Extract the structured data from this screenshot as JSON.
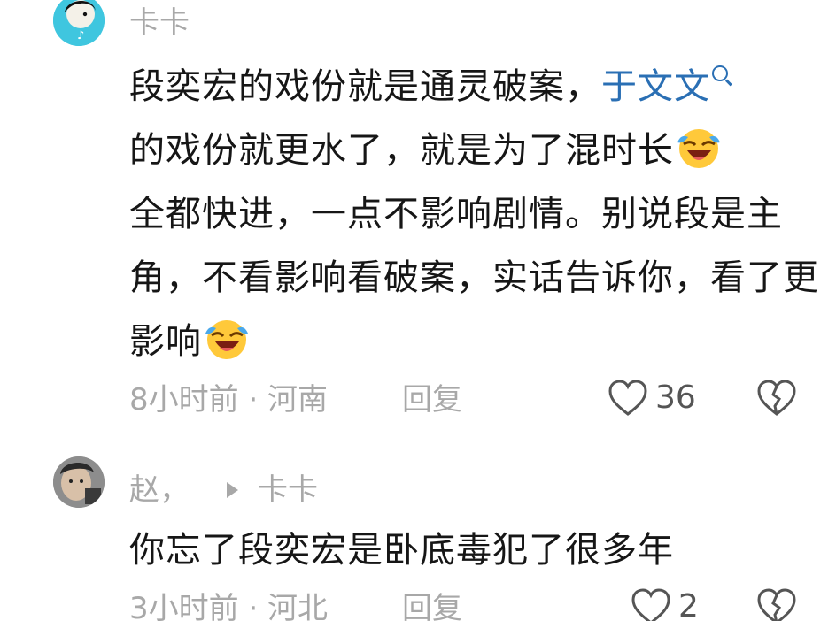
{
  "comments": [
    {
      "username": "卡卡",
      "text_parts": {
        "line_a": "段奕宏的戏份就是通灵破案，",
        "mention": "于文文",
        "line_b": "的戏份就更水了，就是为了混时长",
        "line_c": "全都快进，一点不影响剧情。别说段是主角，不看影响看破案，实话告诉你，看了更影响"
      },
      "emojis": [
        "laughing-tears-emoji",
        "laughing-tears-emoji"
      ],
      "time_location": "8小时前 · 河南",
      "reply_label": "回复",
      "likes": "36"
    },
    {
      "username": "赵，",
      "reply_to": "卡卡",
      "text": "你忘了段奕宏是卧底毒犯了很多年",
      "time_location": "3小时前 · 河北",
      "reply_label": "回复",
      "likes": "2"
    }
  ],
  "icons": {
    "like": "heart-outline-icon",
    "dislike": "broken-heart-icon",
    "search": "search-icon",
    "reply_arrow": "play-arrow-icon"
  },
  "colors": {
    "mention": "#2a6fb4",
    "meta_text": "#a8a8a8",
    "body_text": "#161616"
  }
}
